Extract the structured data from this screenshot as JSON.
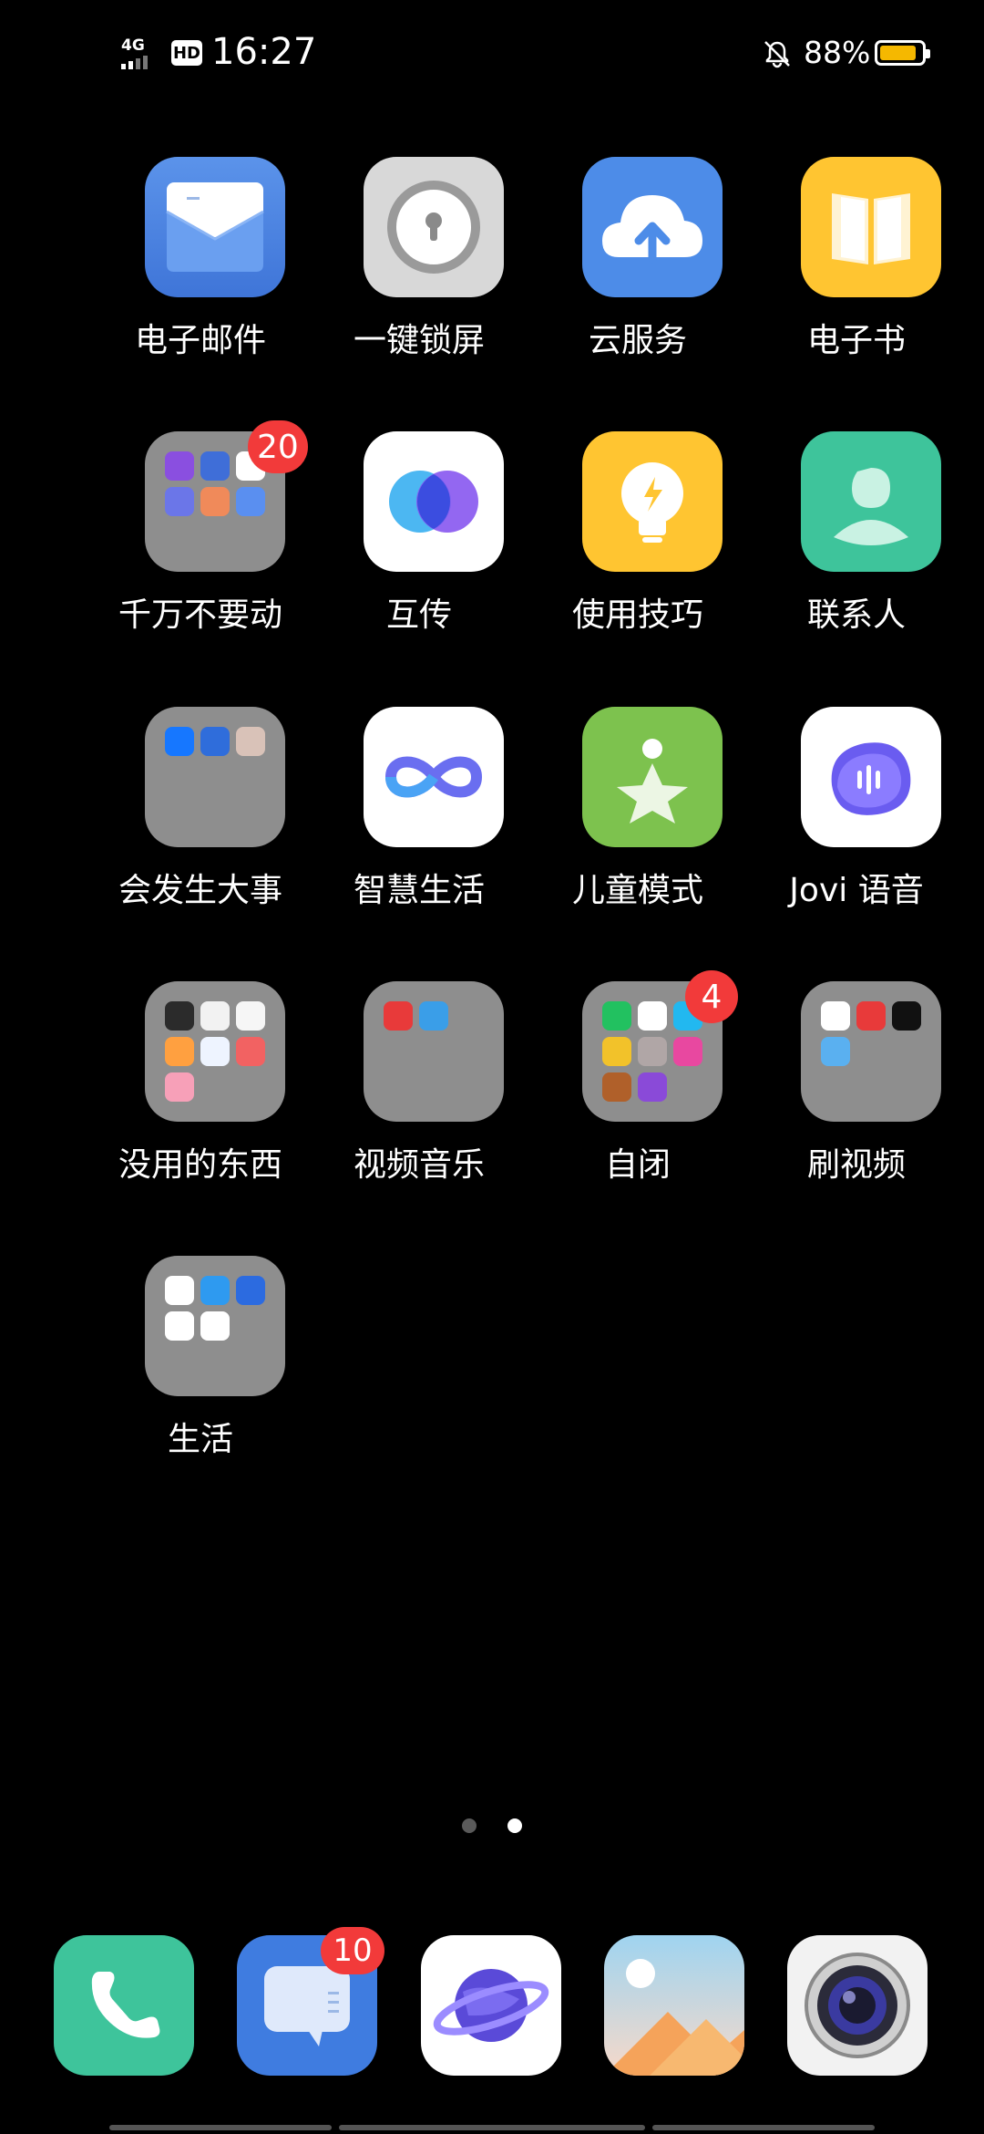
{
  "status_bar": {
    "network": "4G",
    "hd": "HD",
    "time": "16:27",
    "battery_percent": "88%",
    "battery_level": 0.88,
    "icons": [
      "signal-icon",
      "hd-icon",
      "mute-bell-icon",
      "battery-icon"
    ]
  },
  "apps": [
    {
      "label": "电子邮件",
      "icon": "mail-icon"
    },
    {
      "label": "一键锁屏",
      "icon": "lock-screen-icon"
    },
    {
      "label": "云服务",
      "icon": "cloud-upload-icon"
    },
    {
      "label": "电子书",
      "icon": "book-icon"
    },
    {
      "label": "千万不要动",
      "icon": "folder-icon",
      "badge": "20"
    },
    {
      "label": "互传",
      "icon": "share-transfer-icon"
    },
    {
      "label": "使用技巧",
      "icon": "lightbulb-icon"
    },
    {
      "label": "联系人",
      "icon": "contacts-icon"
    },
    {
      "label": "会发生大事",
      "icon": "folder-icon"
    },
    {
      "label": "智慧生活",
      "icon": "infinity-icon"
    },
    {
      "label": "儿童模式",
      "icon": "child-star-icon"
    },
    {
      "label": "Jovi 语音",
      "icon": "voice-assistant-icon"
    },
    {
      "label": "没用的东西",
      "icon": "folder-icon"
    },
    {
      "label": "视频音乐",
      "icon": "folder-icon"
    },
    {
      "label": "自闭",
      "icon": "folder-icon",
      "badge": "4"
    },
    {
      "label": "刷视频",
      "icon": "folder-icon"
    },
    {
      "label": "生活",
      "icon": "folder-icon"
    }
  ],
  "page_indicator": {
    "pages": 2,
    "current": 2
  },
  "dock": [
    {
      "name": "phone",
      "icon": "phone-icon"
    },
    {
      "name": "messages",
      "icon": "message-icon",
      "badge": "10"
    },
    {
      "name": "browser",
      "icon": "planet-browser-icon"
    },
    {
      "name": "gallery",
      "icon": "gallery-icon"
    },
    {
      "name": "camera",
      "icon": "camera-icon"
    }
  ],
  "colors": {
    "background": "#000000",
    "badge": "#f23a3a",
    "folder": "#8e8e8e",
    "battery_fill": "#f5b800"
  }
}
